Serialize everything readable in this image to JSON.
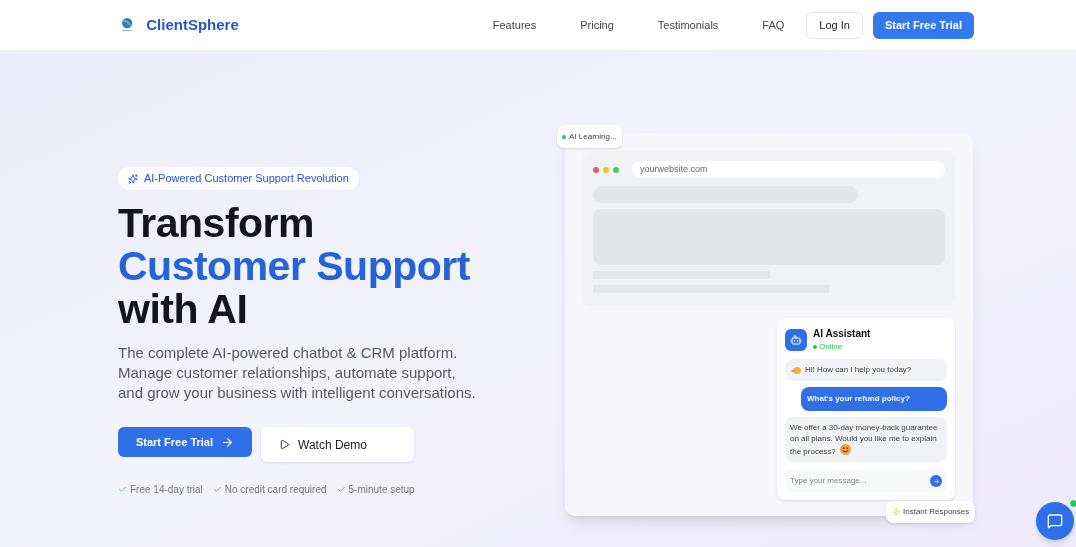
{
  "header": {
    "brand": "ClientSphere",
    "nav": [
      {
        "label": "Features"
      },
      {
        "label": "Pricing"
      },
      {
        "label": "Testimonials"
      },
      {
        "label": "FAQ"
      }
    ],
    "login": "Log In",
    "cta": "Start Free Trial"
  },
  "hero": {
    "badge": "AI-Powered Customer Support Revolution",
    "title_lines": [
      {
        "text": "Transform",
        "accent": false
      },
      {
        "text": "Customer Support",
        "accent": true
      },
      {
        "text": "with AI",
        "accent": false
      }
    ],
    "description": "The complete AI-powered chatbot & CRM platform. Manage customer relationships, automate support, and grow your business with intelligent conversations.",
    "primary_button": "Start Free Trial",
    "secondary_button": "Watch Demo",
    "perks": [
      "Free 14-day trial",
      "No credit card required",
      "5-minute setup"
    ]
  },
  "mockup": {
    "learning_badge": "AI Learning...",
    "url": "yourwebsite.com",
    "chat": {
      "name": "AI Assistant",
      "status": "Online",
      "messages": [
        {
          "kind": "greeting",
          "text": "Hi! How can I help you today?"
        },
        {
          "kind": "question",
          "text": "What's your refund policy?"
        },
        {
          "kind": "reply",
          "text": "We offer a 30-day money-back guarantee on all plans. Would you like me to explain the process?"
        }
      ],
      "placeholder": "Type your message..."
    },
    "instant_badge": "Instant Responses"
  }
}
